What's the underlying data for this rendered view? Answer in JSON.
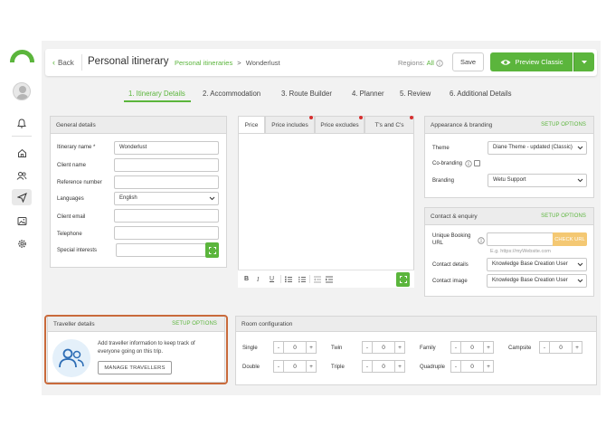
{
  "header": {
    "back": "Back",
    "title": "Personal itinerary",
    "breadcrumb_link": "Personal itineraries",
    "breadcrumb_sep": ">",
    "breadcrumb_current": "Wonderlust",
    "regions_label": "Regions:",
    "regions_value": "All",
    "save": "Save",
    "preview": "Preview Classic"
  },
  "steps": [
    "1. Itinerary Details",
    "2. Accommodation",
    "3. Route Builder",
    "4. Planner",
    "5. Review",
    "6. Additional Details"
  ],
  "general": {
    "title": "General details",
    "fields": [
      {
        "label": "Itinerary name *",
        "value": "Wonderlust"
      },
      {
        "label": "Client name",
        "value": ""
      },
      {
        "label": "Reference number",
        "value": ""
      },
      {
        "label": "Languages",
        "value": "English"
      },
      {
        "label": "Client email",
        "value": ""
      },
      {
        "label": "Telephone",
        "value": ""
      },
      {
        "label": "Special interests",
        "value": ""
      }
    ]
  },
  "editor": {
    "tabs": [
      "Price",
      "Price includes",
      "Price excludes",
      "T's and C's"
    ],
    "toolbar": [
      "B",
      "I",
      "U"
    ]
  },
  "appearance": {
    "title": "Appearance & branding",
    "setup": "SETUP OPTIONS",
    "theme_label": "Theme",
    "theme_value": "Diane Theme - updated (Classic)",
    "cobranding_label": "Co-branding",
    "branding_label": "Branding",
    "branding_value": "Wetu Support"
  },
  "contact": {
    "title": "Contact & enquiry",
    "setup": "SETUP OPTIONS",
    "ubu_label_1": "Unique Booking",
    "ubu_label_2": "URL",
    "check_url": "CHECK URL",
    "url_hint": "E.g. https://myWebsite.com",
    "details_label": "Contact details",
    "details_value": "Knowledge Base Creation User",
    "image_label": "Contact image",
    "image_value": "Knowledge Base Creation User"
  },
  "traveller": {
    "title": "Traveller details",
    "setup": "SETUP OPTIONS",
    "desc_1": "Add traveller information to keep track of",
    "desc_2": "everyone going on this trip.",
    "manage": "MANAGE TRAVELLERS"
  },
  "room": {
    "title": "Room configuration",
    "minus": "-",
    "plus": "+",
    "rows": [
      [
        {
          "label": "Single",
          "value": "0"
        },
        {
          "label": "Twin",
          "value": "0"
        },
        {
          "label": "Family",
          "value": "0"
        },
        {
          "label": "Campsite",
          "value": "0"
        }
      ],
      [
        {
          "label": "Double",
          "value": "0"
        },
        {
          "label": "Triple",
          "value": "0"
        },
        {
          "label": "Quadruple",
          "value": "0"
        }
      ]
    ]
  },
  "colors": {
    "accent": "#5bb53c",
    "highlight": "#c96a3b",
    "badge": "#d62f2f",
    "check_url_bg": "#f4c873"
  }
}
